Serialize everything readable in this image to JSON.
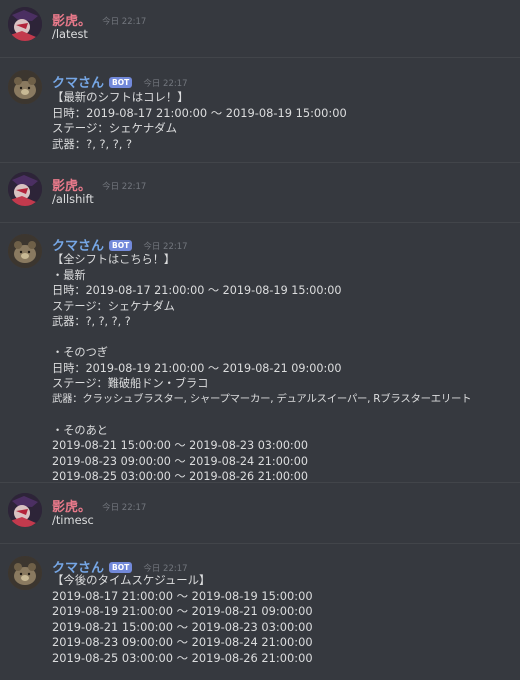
{
  "messages": [
    {
      "author": "影虎。",
      "time": "今日 22:17",
      "lines": [
        "/latest"
      ]
    },
    {
      "author": "クマさん",
      "bot_tag": "BOT",
      "time": "今日 22:17",
      "lines": [
        "【最新のシフトはコレ！】",
        "日時：2019-08-17 21:00:00 〜 2019-08-19 15:00:00",
        "ステージ：シェケナダム",
        "武器：?, ?, ?, ?"
      ]
    },
    {
      "author": "影虎。",
      "time": "今日 22:17",
      "lines": [
        "/allshift"
      ]
    },
    {
      "author": "クマさん",
      "bot_tag": "BOT",
      "time": "今日 22:17",
      "lines": [
        "【全シフトはこちら！】",
        "・最新",
        "日時：2019-08-17 21:00:00 〜 2019-08-19 15:00:00",
        "ステージ：シェケナダム",
        "武器：?, ?, ?, ?",
        "",
        "・そのつぎ",
        "日時：2019-08-19 21:00:00 〜 2019-08-21 09:00:00",
        "ステージ：難破船ドン・ブラコ",
        "武器：クラッシュブラスター, シャープマーカー, デュアルスイーパー, Rブラスターエリート",
        "",
        "・そのあと",
        "2019-08-21 15:00:00 〜 2019-08-23 03:00:00",
        "2019-08-23 09:00:00 〜 2019-08-24 21:00:00",
        "2019-08-25 03:00:00 〜 2019-08-26 21:00:00"
      ]
    },
    {
      "author": "影虎。",
      "time": "今日 22:17",
      "lines": [
        "/timesc"
      ]
    },
    {
      "author": "クマさん",
      "bot_tag": "BOT",
      "time": "今日 22:17",
      "lines": [
        "【今後のタイムスケジュール】",
        "2019-08-17 21:00:00 〜 2019-08-19 15:00:00",
        "2019-08-19 21:00:00 〜 2019-08-21 09:00:00",
        "2019-08-21 15:00:00 〜 2019-08-23 03:00:00",
        "2019-08-23 09:00:00 〜 2019-08-24 21:00:00",
        "2019-08-25 03:00:00 〜 2019-08-26 21:00:00"
      ]
    }
  ],
  "colors": {
    "background": "#36393f",
    "user_name": "#e8798a",
    "bot_name": "#76a7e6",
    "bot_tag": "#7289da",
    "timestamp": "#72767d",
    "text": "#dcddde"
  }
}
